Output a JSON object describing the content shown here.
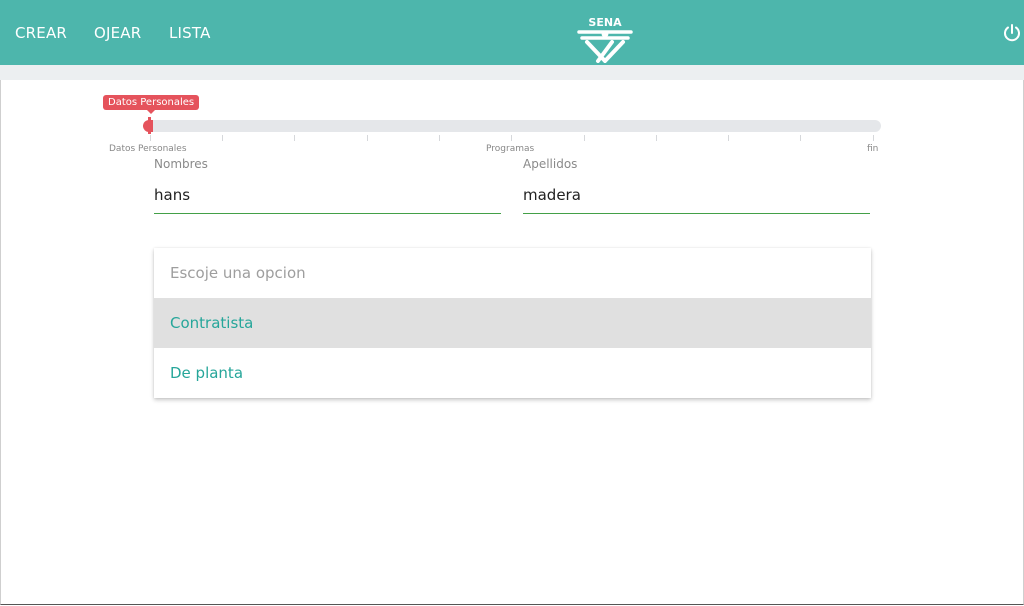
{
  "header": {
    "nav": [
      "CREAR",
      "OJEAR",
      "LISTA"
    ],
    "logo_text": "SENA",
    "power_icon": "power-icon",
    "background_color": "#4db6ac"
  },
  "progress": {
    "tooltip": "Datos Personales",
    "labels": [
      "Datos Personales",
      "Programas",
      "fin"
    ],
    "value": 0,
    "accent_color": "#e5535c"
  },
  "form": {
    "nombres": {
      "label": "Nombres",
      "value": "hans"
    },
    "apellidos": {
      "label": "Apellidos",
      "value": "madera"
    }
  },
  "dropdown": {
    "placeholder": "Escoje una opcion",
    "options": [
      "Contratista",
      "De planta"
    ],
    "highlighted": "Contratista",
    "option_color": "#26a69a"
  }
}
